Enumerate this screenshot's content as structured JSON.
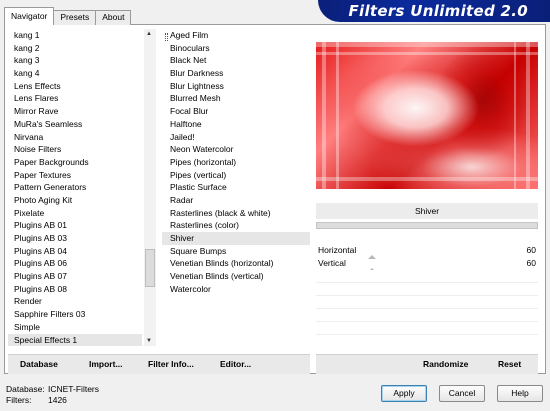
{
  "tabs": [
    "Navigator",
    "Presets",
    "About"
  ],
  "banner_title": "Filters Unlimited 2.0",
  "categories": [
    "kang 1",
    "kang 2",
    "kang 3",
    "kang 4",
    "Lens Effects",
    "Lens Flares",
    "Mirror Rave",
    "MuRa's Seamless",
    "Nirvana",
    "Noise Filters",
    "Paper Backgrounds",
    "Paper Textures",
    "Pattern Generators",
    "Photo Aging Kit",
    "Pixelate",
    "Plugins AB 01",
    "Plugins AB 03",
    "Plugins AB 04",
    "Plugins AB 06",
    "Plugins AB 07",
    "Plugins AB 08",
    "Render",
    "Sapphire Filters 03",
    "Simple",
    "Special Effects 1"
  ],
  "selected_category": "Special Effects 1",
  "filters": [
    "Aged Film",
    "Binoculars",
    "Black Net",
    "Blur Darkness",
    "Blur Lightness",
    "Blurred Mesh",
    "Focal Blur",
    "Halftone",
    "Jailed!",
    "Neon Watercolor",
    "Pipes (horizontal)",
    "Pipes (vertical)",
    "Plastic Surface",
    "Radar",
    "Rasterlines (black & white)",
    "Rasterlines (color)",
    "Shiver",
    "Square Bumps",
    "Venetian Blinds (horizontal)",
    "Venetian Blinds (vertical)",
    "Watercolor"
  ],
  "selected_filter": "Shiver",
  "left_buttons": {
    "database": "Database",
    "import": "Import...",
    "filter_info": "Filter Info...",
    "editor": "Editor..."
  },
  "right_buttons": {
    "randomize": "Randomize",
    "reset": "Reset"
  },
  "filter_name": "Shiver",
  "params": [
    {
      "label": "Horizontal",
      "value": "60"
    },
    {
      "label": "Vertical",
      "value": "60"
    }
  ],
  "footer": {
    "database_label": "Database:",
    "database_value": "ICNET-Filters",
    "filters_label": "Filters:",
    "filters_value": "1426"
  },
  "dialog_buttons": {
    "apply": "Apply",
    "cancel": "Cancel",
    "help": "Help"
  },
  "colors": {
    "banner": "#0b2a9c",
    "preview_red": "#d40000",
    "default_button": "#3c7fb1"
  }
}
